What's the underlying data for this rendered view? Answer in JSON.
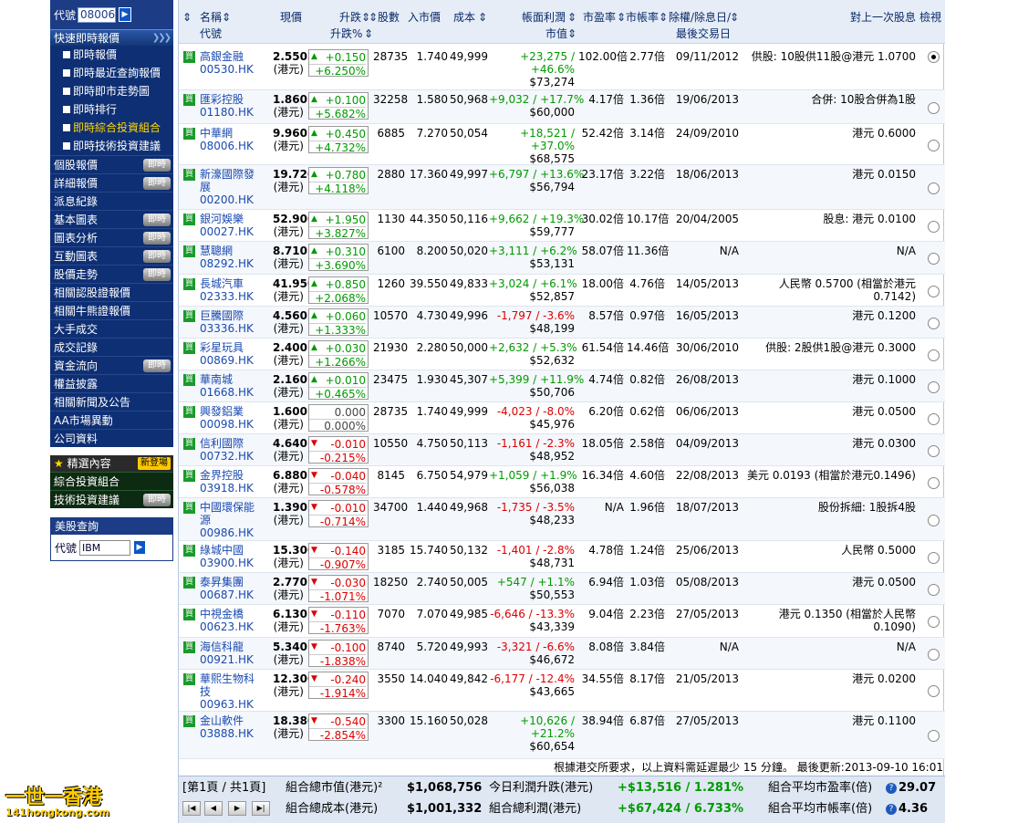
{
  "sidebar": {
    "code_label": "代號",
    "code_value": "08006",
    "quick_head": "快速即時報價",
    "quick_items": [
      "即時報價",
      "即時最近查詢報價",
      "即時即市走勢圖",
      "即時排行",
      "即時綜合投資組合",
      "即時技術投資建議"
    ],
    "nav": [
      {
        "label": "個股報價",
        "badge": "即時"
      },
      {
        "label": "詳細報價",
        "badge": "即時"
      },
      {
        "label": "派息紀錄",
        "badge": ""
      },
      {
        "label": "基本圖表",
        "badge": "即時"
      },
      {
        "label": "圖表分析",
        "badge": "即時"
      },
      {
        "label": "互動圖表",
        "badge": "即時"
      },
      {
        "label": "股價走勢",
        "badge": "即時"
      },
      {
        "label": "相關認股證報價",
        "badge": ""
      },
      {
        "label": "相關牛熊證報價",
        "badge": ""
      },
      {
        "label": "大手成交",
        "badge": ""
      },
      {
        "label": "成交記錄",
        "badge": ""
      },
      {
        "label": "資金流向",
        "badge": "即時"
      },
      {
        "label": "權益披露",
        "badge": ""
      },
      {
        "label": "相關新聞及公告",
        "badge": ""
      },
      {
        "label": "AA市場異動",
        "badge": ""
      },
      {
        "label": "公司資料",
        "badge": ""
      }
    ],
    "featured_head": "精選內容",
    "featured_new": "新登場",
    "featured_items": [
      {
        "label": "綜合投資組合",
        "badge": ""
      },
      {
        "label": "技術投資建議",
        "badge": "即時"
      }
    ],
    "us_head": "美股查詢",
    "us_label": "代號",
    "us_value": "IBM"
  },
  "header": {
    "name": "名稱",
    "code": "代號",
    "price": "現價",
    "change": "升跌",
    "change_pct": "升跌%",
    "shares": "股數",
    "cost_price": "入市價",
    "cost": "成本",
    "book_pl": "帳面利潤",
    "market_value": "市值",
    "pe": "市盈率",
    "pb": "市帳率",
    "exdate1": "除權/除息日/",
    "exdate2": "最後交易日",
    "dividend": "對上一次股息",
    "view": "檢視"
  },
  "rows": [
    {
      "name": "高銀金融",
      "code": "00530.HK",
      "price": "2.550",
      "unit": "(港元)",
      "chg": "+0.150",
      "pct": "+6.250%",
      "dir": "up",
      "shares": "28735",
      "cost_price": "1.740",
      "cost": "49,999",
      "pl": "+23,275 /",
      "pl_pct": "+46.6%",
      "mv": "$73,274",
      "pe": "102.00倍",
      "pb": "2.77倍",
      "date": "09/11/2012",
      "div": "供股: 10股供11股@港元 1.0700",
      "div2": "",
      "sel": true
    },
    {
      "name": "匯彩控股",
      "code": "01180.HK",
      "price": "1.860",
      "unit": "(港元)",
      "chg": "+0.100",
      "pct": "+5.682%",
      "dir": "up",
      "shares": "32258",
      "cost_price": "1.580",
      "cost": "50,968",
      "pl": "+9,032 / +17.7%",
      "pl_pct": "",
      "mv": "$60,000",
      "pe": "4.17倍",
      "pb": "1.36倍",
      "date": "19/06/2013",
      "div": "合併: 10股合併為1股",
      "div2": "",
      "sel": false
    },
    {
      "name": "中華網",
      "code": "08006.HK",
      "price": "9.960",
      "unit": "(港元)",
      "chg": "+0.450",
      "pct": "+4.732%",
      "dir": "up",
      "shares": "6885",
      "cost_price": "7.270",
      "cost": "50,054",
      "pl": "+18,521 /",
      "pl_pct": "+37.0%",
      "mv": "$68,575",
      "pe": "52.42倍",
      "pb": "3.14倍",
      "date": "24/09/2010",
      "div": "港元 0.6000",
      "div2": "",
      "sel": false
    },
    {
      "name": "新濠國際發展",
      "name2": "展",
      "code": "00200.HK",
      "price": "19.720",
      "unit": "(港元)",
      "chg": "+0.780",
      "pct": "+4.118%",
      "dir": "up",
      "shares": "2880",
      "cost_price": "17.360",
      "cost": "49,997",
      "pl": "+6,797 / +13.6%",
      "pl_pct": "",
      "mv": "$56,794",
      "pe": "23.17倍",
      "pb": "3.22倍",
      "date": "18/06/2013",
      "div": "港元 0.0150",
      "div2": "",
      "sel": false
    },
    {
      "name": "銀河娛樂",
      "code": "00027.HK",
      "price": "52.900",
      "unit": "(港元)",
      "chg": "+1.950",
      "pct": "+3.827%",
      "dir": "up",
      "shares": "1130",
      "cost_price": "44.350",
      "cost": "50,116",
      "pl": "+9,662 / +19.3%",
      "pl_pct": "",
      "mv": "$59,777",
      "pe": "30.02倍",
      "pb": "10.17倍",
      "date": "20/04/2005",
      "div": "股息: 港元 0.0100",
      "div2": "",
      "sel": false
    },
    {
      "name": "慧聰網",
      "code": "08292.HK",
      "price": "8.710",
      "unit": "(港元)",
      "chg": "+0.310",
      "pct": "+3.690%",
      "dir": "up",
      "shares": "6100",
      "cost_price": "8.200",
      "cost": "50,020",
      "pl": "+3,111 / +6.2%",
      "pl_pct": "",
      "mv": "$53,131",
      "pe": "58.07倍",
      "pb": "11.36倍",
      "date": "N/A",
      "div": "N/A",
      "div2": "",
      "sel": false
    },
    {
      "name": "長城汽車",
      "code": "02333.HK",
      "price": "41.950",
      "unit": "(港元)",
      "chg": "+0.850",
      "pct": "+2.068%",
      "dir": "up",
      "shares": "1260",
      "cost_price": "39.550",
      "cost": "49,833",
      "pl": "+3,024 / +6.1%",
      "pl_pct": "",
      "mv": "$52,857",
      "pe": "18.00倍",
      "pb": "4.76倍",
      "date": "14/05/2013",
      "div": "人民幣 0.5700 (相當於港元",
      "div2": "0.7142)",
      "sel": false
    },
    {
      "name": "巨騰國際",
      "code": "03336.HK",
      "price": "4.560",
      "unit": "(港元)",
      "chg": "+0.060",
      "pct": "+1.333%",
      "dir": "up",
      "shares": "10570",
      "cost_price": "4.730",
      "cost": "49,996",
      "pl": "-1,797 / -3.6%",
      "pl_pct": "",
      "mv": "$48,199",
      "pe": "8.57倍",
      "pb": "0.97倍",
      "date": "16/05/2013",
      "div": "港元 0.1200",
      "div2": "",
      "sel": false
    },
    {
      "name": "彩星玩具",
      "code": "00869.HK",
      "price": "2.400",
      "unit": "(港元)",
      "chg": "+0.030",
      "pct": "+1.266%",
      "dir": "up",
      "shares": "21930",
      "cost_price": "2.280",
      "cost": "50,000",
      "pl": "+2,632 / +5.3%",
      "pl_pct": "",
      "mv": "$52,632",
      "pe": "61.54倍",
      "pb": "14.46倍",
      "date": "30/06/2010",
      "div": "供股: 2股供1股@港元 0.3000",
      "div2": "",
      "sel": false
    },
    {
      "name": "華南城",
      "code": "01668.HK",
      "price": "2.160",
      "unit": "(港元)",
      "chg": "+0.010",
      "pct": "+0.465%",
      "dir": "up",
      "shares": "23475",
      "cost_price": "1.930",
      "cost": "45,307",
      "pl": "+5,399 / +11.9%",
      "pl_pct": "",
      "mv": "$50,706",
      "pe": "4.74倍",
      "pb": "0.82倍",
      "date": "26/08/2013",
      "div": "港元 0.1000",
      "div2": "",
      "sel": false
    },
    {
      "name": "興發鋁業",
      "code": "00098.HK",
      "price": "1.600",
      "unit": "(港元)",
      "chg": "0.000",
      "pct": "0.000%",
      "dir": "nc",
      "shares": "28735",
      "cost_price": "1.740",
      "cost": "49,999",
      "pl": "-4,023 / -8.0%",
      "pl_pct": "",
      "mv": "$45,976",
      "pe": "6.20倍",
      "pb": "0.62倍",
      "date": "06/06/2013",
      "div": "港元 0.0500",
      "div2": "",
      "sel": false
    },
    {
      "name": "信利國際",
      "code": "00732.HK",
      "price": "4.640",
      "unit": "(港元)",
      "chg": "-0.010",
      "pct": "-0.215%",
      "dir": "dn",
      "shares": "10550",
      "cost_price": "4.750",
      "cost": "50,113",
      "pl": "-1,161 / -2.3%",
      "pl_pct": "",
      "mv": "$48,952",
      "pe": "18.05倍",
      "pb": "2.58倍",
      "date": "04/09/2013",
      "div": "港元 0.0300",
      "div2": "",
      "sel": false
    },
    {
      "name": "金界控股",
      "code": "03918.HK",
      "price": "6.880",
      "unit": "(港元)",
      "chg": "-0.040",
      "pct": "-0.578%",
      "dir": "dn",
      "shares": "8145",
      "cost_price": "6.750",
      "cost": "54,979",
      "pl": "+1,059 / +1.9%",
      "pl_pct": "",
      "mv": "$56,038",
      "pe": "16.34倍",
      "pb": "4.60倍",
      "date": "22/08/2013",
      "div": "美元 0.0193 (相當於港元0.1496)",
      "div2": "",
      "sel": false
    },
    {
      "name": "中國環保能",
      "name2": "源",
      "code": "00986.HK",
      "price": "1.390",
      "unit": "(港元)",
      "chg": "-0.010",
      "pct": "-0.714%",
      "dir": "dn",
      "shares": "34700",
      "cost_price": "1.440",
      "cost": "49,968",
      "pl": "-1,735 / -3.5%",
      "pl_pct": "",
      "mv": "$48,233",
      "pe": "N/A",
      "pb": "1.96倍",
      "date": "18/07/2013",
      "div": "股份拆細: 1股拆4股",
      "div2": "",
      "sel": false
    },
    {
      "name": "綠城中國",
      "code": "03900.HK",
      "price": "15.300",
      "unit": "(港元)",
      "chg": "-0.140",
      "pct": "-0.907%",
      "dir": "dn",
      "shares": "3185",
      "cost_price": "15.740",
      "cost": "50,132",
      "pl": "-1,401 / -2.8%",
      "pl_pct": "",
      "mv": "$48,731",
      "pe": "4.78倍",
      "pb": "1.24倍",
      "date": "25/06/2013",
      "div": "人民幣 0.5000",
      "div2": "",
      "sel": false
    },
    {
      "name": "泰昇集團",
      "code": "00687.HK",
      "price": "2.770",
      "unit": "(港元)",
      "chg": "-0.030",
      "pct": "-1.071%",
      "dir": "dn",
      "shares": "18250",
      "cost_price": "2.740",
      "cost": "50,005",
      "pl": "+547 / +1.1%",
      "pl_pct": "",
      "mv": "$50,553",
      "pe": "6.94倍",
      "pb": "1.03倍",
      "date": "05/08/2013",
      "div": "港元 0.0500",
      "div2": "",
      "sel": false
    },
    {
      "name": "中視金橋",
      "code": "00623.HK",
      "price": "6.130",
      "unit": "(港元)",
      "chg": "-0.110",
      "pct": "-1.763%",
      "dir": "dn",
      "shares": "7070",
      "cost_price": "7.070",
      "cost": "49,985",
      "pl": "-6,646 / -13.3%",
      "pl_pct": "",
      "mv": "$43,339",
      "pe": "9.04倍",
      "pb": "2.23倍",
      "date": "27/05/2013",
      "div": "港元 0.1350 (相當於人民幣",
      "div2": "0.1090)",
      "sel": false
    },
    {
      "name": "海信科龍",
      "code": "00921.HK",
      "price": "5.340",
      "unit": "(港元)",
      "chg": "-0.100",
      "pct": "-1.838%",
      "dir": "dn",
      "shares": "8740",
      "cost_price": "5.720",
      "cost": "49,993",
      "pl": "-3,321 / -6.6%",
      "pl_pct": "",
      "mv": "$46,672",
      "pe": "8.08倍",
      "pb": "3.84倍",
      "date": "N/A",
      "div": "N/A",
      "div2": "",
      "sel": false
    },
    {
      "name": "華熙生物科",
      "name2": "技",
      "code": "00963.HK",
      "price": "12.300",
      "unit": "(港元)",
      "chg": "-0.240",
      "pct": "-1.914%",
      "dir": "dn",
      "shares": "3550",
      "cost_price": "14.040",
      "cost": "49,842",
      "pl": "-6,177 / -12.4%",
      "pl_pct": "",
      "mv": "$43,665",
      "pe": "34.55倍",
      "pb": "8.17倍",
      "date": "21/05/2013",
      "div": "港元 0.0200",
      "div2": "",
      "sel": false
    },
    {
      "name": "金山軟件",
      "code": "03888.HK",
      "price": "18.380",
      "unit": "(港元)",
      "chg": "-0.540",
      "pct": "-2.854%",
      "dir": "dn",
      "shares": "3300",
      "cost_price": "15.160",
      "cost": "50,028",
      "pl": "+10,626 /",
      "pl_pct": "+21.2%",
      "mv": "$60,654",
      "pe": "38.94倍",
      "pb": "6.87倍",
      "date": "27/05/2013",
      "div": "港元 0.1100",
      "div2": "",
      "sel": false
    }
  ],
  "note": "根據港交所要求，以上資料需延遲最少 15 分鐘。 最後更新:2013-09-10 16:01",
  "footer": {
    "page": "[第1頁 / 共1頁]",
    "total_value_label": "組合總市值(港元)²",
    "total_value": "$1,068,756",
    "total_cost_label": "組合總成本(港元)",
    "total_cost": "$1,001,332",
    "today_pl_label": "今日利潤升跌(港元)",
    "today_pl": "+$13,516 / 1.281%",
    "total_pl_label": "組合總利潤(港元)",
    "total_pl": "+$67,424 / 6.733%",
    "avg_pe_label": "組合平均市盈率(倍)",
    "avg_pe": "29.07",
    "avg_pb_label": "組合平均市帳率(倍)",
    "avg_pb": "4.36"
  },
  "logo": {
    "text1": "一世一香港",
    "text2": "141hongkong.com"
  },
  "colors": {
    "up": "#009a00",
    "down": "#dd0000",
    "nav_bg": "#0e2f74",
    "header_bg": "#e6edf6"
  }
}
